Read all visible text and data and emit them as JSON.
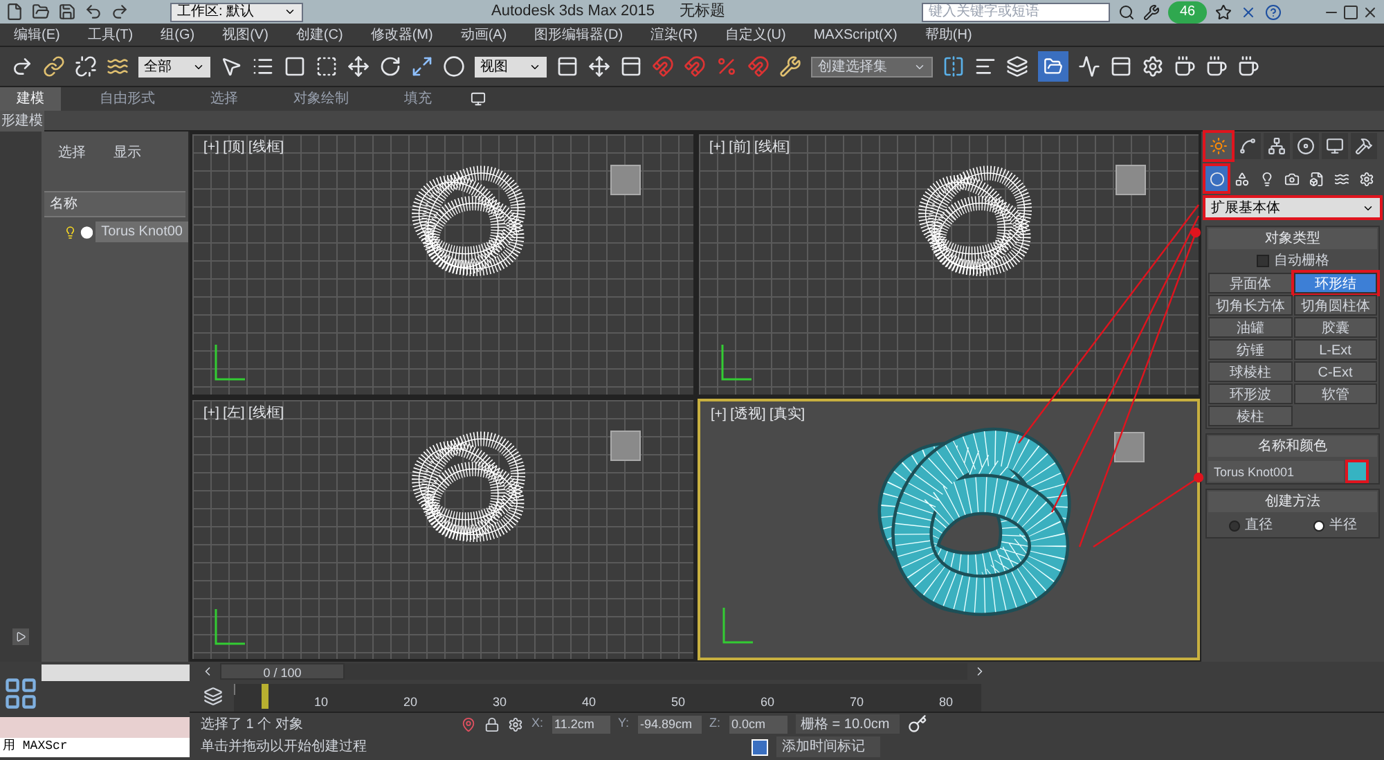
{
  "title_bar": {
    "workspace": "工作区: 默认",
    "title": "Autodesk 3ds Max  2015",
    "document": "无标题",
    "search": {
      "placeholder": "键入关键字或短语"
    },
    "badge": "46"
  },
  "menu": [
    "编辑(E)",
    "工具(T)",
    "组(G)",
    "视图(V)",
    "创建(C)",
    "修改器(M)",
    "动画(A)",
    "图形编辑器(D)",
    "渲染(R)",
    "自定义(U)",
    "MAXScript(X)",
    "帮助(H)"
  ],
  "toolbar": {
    "selection_filter": "全部",
    "reference_coord": "视图",
    "named_selection": "创建选择集"
  },
  "ribbon": {
    "tabs": [
      {
        "label": "建模",
        "selected": true
      },
      {
        "label": "自由形式",
        "selected": false
      },
      {
        "label": "选择",
        "selected": false
      },
      {
        "label": "对象绘制",
        "selected": false
      },
      {
        "label": "填充",
        "selected": false
      }
    ],
    "panel_label": "形建模"
  },
  "scene_explorer": {
    "tabs": [
      "选择",
      "显示"
    ],
    "column": "名称",
    "rows": [
      {
        "name": "Torus Knot00",
        "selected": true
      }
    ]
  },
  "viewports": [
    {
      "label": "[+] [顶] [线框]",
      "kind": "wire",
      "active": false
    },
    {
      "label": "[+] [前] [线框]",
      "kind": "wire",
      "active": false
    },
    {
      "label": "[+] [左] [线框]",
      "kind": "wire",
      "active": false
    },
    {
      "label": "[+] [透视] [真实]",
      "kind": "shaded",
      "active": true
    }
  ],
  "command_panel": {
    "tabs": [
      {
        "selected": true,
        "highlighted": true
      },
      {
        "selected": false,
        "highlighted": false
      },
      {
        "selected": false,
        "highlighted": false
      },
      {
        "selected": false,
        "highlighted": false
      },
      {
        "selected": false,
        "highlighted": false
      },
      {
        "selected": false,
        "highlighted": false
      }
    ],
    "categories": [
      {
        "selected": true,
        "highlighted": true
      },
      {
        "selected": false,
        "highlighted": false
      },
      {
        "selected": false,
        "highlighted": false
      },
      {
        "selected": false,
        "highlighted": false
      },
      {
        "selected": false,
        "highlighted": false
      },
      {
        "selected": false,
        "highlighted": false
      },
      {
        "selected": false,
        "highlighted": false
      }
    ],
    "dropdown": {
      "value": "扩展基本体",
      "highlighted": true
    },
    "object_type": {
      "title": "对象类型",
      "autogrid": {
        "label": "自动栅格",
        "checked": false
      },
      "buttons": [
        {
          "label": "异面体",
          "selected": false,
          "highlighted": false
        },
        {
          "label": "环形结",
          "selected": true,
          "highlighted": true
        },
        {
          "label": "切角长方体",
          "selected": false,
          "highlighted": false
        },
        {
          "label": "切角圆柱体",
          "selected": false,
          "highlighted": false
        },
        {
          "label": "油罐",
          "selected": false,
          "highlighted": false
        },
        {
          "label": "胶囊",
          "selected": false,
          "highlighted": false
        },
        {
          "label": "纺锤",
          "selected": false,
          "highlighted": false
        },
        {
          "label": "L-Ext",
          "selected": false,
          "highlighted": false
        },
        {
          "label": "球棱柱",
          "selected": false,
          "highlighted": false
        },
        {
          "label": "C-Ext",
          "selected": false,
          "highlighted": false
        },
        {
          "label": "环形波",
          "selected": false,
          "highlighted": false
        },
        {
          "label": "软管",
          "selected": false,
          "highlighted": false
        },
        {
          "label": "棱柱",
          "selected": false,
          "highlighted": false
        }
      ]
    },
    "name_color": {
      "title": "名称和颜色",
      "name": "Torus Knot001",
      "color": "#36b3c2",
      "highlighted": true
    },
    "creation_method": {
      "title": "创建方法",
      "options": [
        {
          "label": "直径",
          "selected": false
        },
        {
          "label": "半径",
          "selected": true
        }
      ]
    }
  },
  "timeline": {
    "position": "0 / 100",
    "level": 0,
    "ticks": [
      "10",
      "20",
      "30",
      "40",
      "50",
      "60",
      "70",
      "80"
    ]
  },
  "status": {
    "selection": "选择了 1 个 对象",
    "prompt": "单击并拖动以开始创建过程",
    "x_label": "X:",
    "x": "11.2cm",
    "y_label": "Y:",
    "y": "-94.89cm",
    "z_label": "Z:",
    "z": "0.0cm",
    "grid": "栅格 = 10.0cm",
    "time_tag": "添加时间标记"
  },
  "maxscript": {
    "label": "用 MAXScr"
  }
}
